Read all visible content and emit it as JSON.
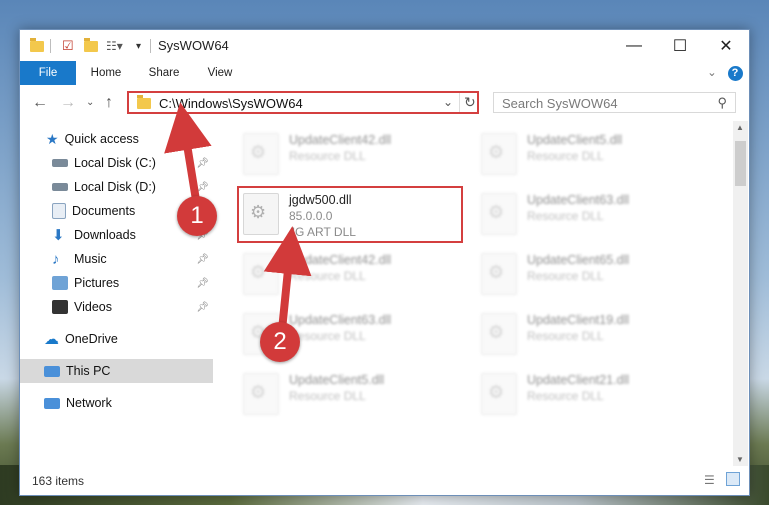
{
  "window": {
    "title": "SysWOW64"
  },
  "ribbon": {
    "tabs": [
      "File",
      "Home",
      "Share",
      "View"
    ]
  },
  "address": {
    "path": "C:\\Windows\\SysWOW64"
  },
  "search": {
    "placeholder": "Search SysWOW64"
  },
  "nav": {
    "quick_access": "Quick access",
    "items": [
      {
        "label": "Local Disk (C:)",
        "icon": "drive-icon",
        "pinned": true
      },
      {
        "label": "Local Disk (D:)",
        "icon": "drive-icon",
        "pinned": true
      },
      {
        "label": "Documents",
        "icon": "documents-icon",
        "pinned": true
      },
      {
        "label": "Downloads",
        "icon": "downloads-icon",
        "pinned": true
      },
      {
        "label": "Music",
        "icon": "music-icon",
        "pinned": true
      },
      {
        "label": "Pictures",
        "icon": "pictures-icon",
        "pinned": true
      },
      {
        "label": "Videos",
        "icon": "videos-icon",
        "pinned": true
      }
    ],
    "onedrive": "OneDrive",
    "this_pc": "This PC",
    "network": "Network"
  },
  "files": {
    "col1": [
      {
        "name": "UpdateClient42.dll",
        "type": "Resource DLL"
      },
      {
        "name": "jgdw500.dll",
        "version": "85.0.0.0",
        "type": "JG ART DLL"
      },
      {
        "name": "UpdateClient42.dll",
        "type": "Resource DLL"
      },
      {
        "name": "UpdateClient63.dll",
        "type": "Resource DLL"
      },
      {
        "name": "UpdateClient5.dll",
        "type": "Resource DLL"
      }
    ],
    "col2": [
      {
        "name": "UpdateClient5.dll",
        "type": "Resource DLL"
      },
      {
        "name": "UpdateClient63.dll",
        "type": "Resource DLL"
      },
      {
        "name": "UpdateClient65.dll",
        "type": "Resource DLL"
      },
      {
        "name": "UpdateClient19.dll",
        "type": "Resource DLL"
      },
      {
        "name": "UpdateClient21.dll",
        "type": "Resource DLL"
      }
    ]
  },
  "status": {
    "count": "163 items"
  },
  "annotations": {
    "badge1": "1",
    "badge2": "2"
  },
  "colors": {
    "accent": "#1979ca",
    "highlight": "#d43f3f"
  }
}
